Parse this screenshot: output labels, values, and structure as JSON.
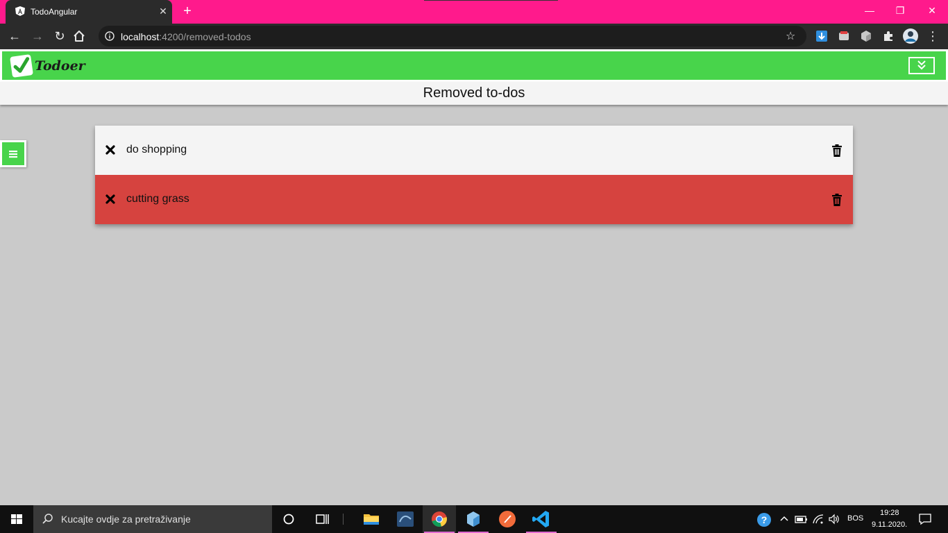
{
  "browser": {
    "tab_title": "TodoAngular",
    "tab_close": "✕",
    "new_tab": "+",
    "url_host": "localhost",
    "url_path": ":4200/removed-todos",
    "window_controls": [
      "—",
      "❐",
      "✕"
    ]
  },
  "app": {
    "logo_text": "Todoer",
    "page_title": "Removed to-dos",
    "colors": {
      "accent": "#48d44b",
      "removed_highlight": "#d6433f"
    }
  },
  "todos": [
    {
      "text": "do shopping"
    },
    {
      "text": "cutting grass"
    }
  ],
  "taskbar": {
    "search_placeholder": "Kucajte ovdje za pretraživanje",
    "language": "BOS",
    "time": "19:28",
    "date": "9.11.2020."
  }
}
